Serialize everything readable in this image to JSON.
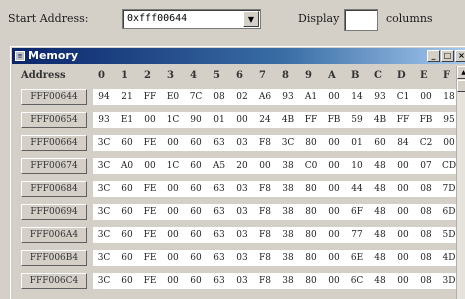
{
  "toolbar": {
    "start_address_label": "Start Address:",
    "start_address_value": "0xfff00644",
    "display_label": "Display",
    "columns_label": "columns",
    "columns_value": ""
  },
  "window": {
    "title": "Memory",
    "minimize": "_",
    "restore": "□",
    "close": "×"
  },
  "table": {
    "address_header": "Address",
    "byte_headers": [
      "0",
      "1",
      "2",
      "3",
      "4",
      "5",
      "6",
      "7",
      "8",
      "9",
      "A",
      "B",
      "C",
      "D",
      "E",
      "F"
    ],
    "rows": [
      {
        "address": "FFF00644",
        "bytes": [
          "94",
          "21",
          "FF",
          "E0",
          "7C",
          "08",
          "02",
          "A6",
          "93",
          "A1",
          "00",
          "14",
          "93",
          "C1",
          "00",
          "18"
        ]
      },
      {
        "address": "FFF00654",
        "bytes": [
          "93",
          "E1",
          "00",
          "1C",
          "90",
          "01",
          "00",
          "24",
          "4B",
          "FF",
          "FB",
          "59",
          "4B",
          "FF",
          "FB",
          "95"
        ]
      },
      {
        "address": "FFF00664",
        "bytes": [
          "3C",
          "60",
          "FE",
          "00",
          "60",
          "63",
          "03",
          "F8",
          "3C",
          "80",
          "00",
          "01",
          "60",
          "84",
          "C2",
          "00"
        ]
      },
      {
        "address": "FFF00674",
        "bytes": [
          "3C",
          "A0",
          "00",
          "1C",
          "60",
          "A5",
          "20",
          "00",
          "38",
          "C0",
          "00",
          "10",
          "48",
          "00",
          "07",
          "CD"
        ]
      },
      {
        "address": "FFF00684",
        "bytes": [
          "3C",
          "60",
          "FE",
          "00",
          "60",
          "63",
          "03",
          "F8",
          "38",
          "80",
          "00",
          "44",
          "48",
          "00",
          "08",
          "7D"
        ]
      },
      {
        "address": "FFF00694",
        "bytes": [
          "3C",
          "60",
          "FE",
          "00",
          "60",
          "63",
          "03",
          "F8",
          "38",
          "80",
          "00",
          "6F",
          "48",
          "00",
          "08",
          "6D"
        ]
      },
      {
        "address": "FFF006A4",
        "bytes": [
          "3C",
          "60",
          "FE",
          "00",
          "60",
          "63",
          "03",
          "F8",
          "38",
          "80",
          "00",
          "77",
          "48",
          "00",
          "08",
          "5D"
        ]
      },
      {
        "address": "FFF006B4",
        "bytes": [
          "3C",
          "60",
          "FE",
          "00",
          "60",
          "63",
          "03",
          "F8",
          "38",
          "80",
          "00",
          "6E",
          "48",
          "00",
          "08",
          "4D"
        ]
      },
      {
        "address": "FFF006C4",
        "bytes": [
          "3C",
          "60",
          "FE",
          "00",
          "60",
          "63",
          "03",
          "F8",
          "38",
          "80",
          "00",
          "6C",
          "48",
          "00",
          "08",
          "3D"
        ]
      }
    ]
  },
  "icons": {
    "dropdown": "chevron-down-icon",
    "window": "memory-window-icon",
    "scroll_up": "arrow-up-icon"
  },
  "colors": {
    "titlebar_start": "#0a246a",
    "titlebar_end": "#a6caf0",
    "panel": "#d4d0c8"
  }
}
